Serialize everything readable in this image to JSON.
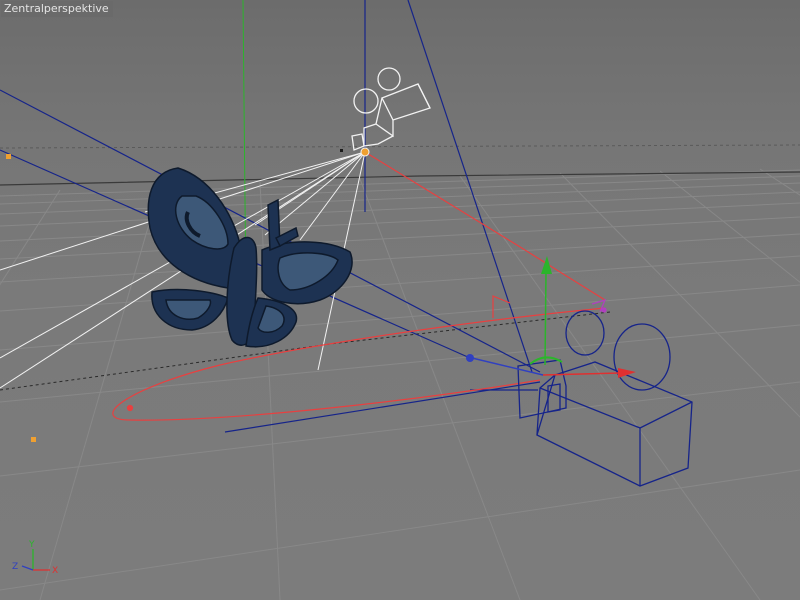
{
  "viewport": {
    "label": "Zentralperspektive"
  },
  "colors": {
    "grid": "#8c8c8c",
    "horizon": "#2a2a2a",
    "y_axis": "#2bb52b",
    "x_axis": "#e03030",
    "z_axis": "#3040c0",
    "wire_blue": "#16248a",
    "wire_white": "#f2f2f2",
    "target_path": "#e84040",
    "butterfly": "#1d3252",
    "handle": "#f0a030"
  },
  "axis_gizmo": {
    "y": "Y",
    "z": "Z",
    "x": "X"
  }
}
